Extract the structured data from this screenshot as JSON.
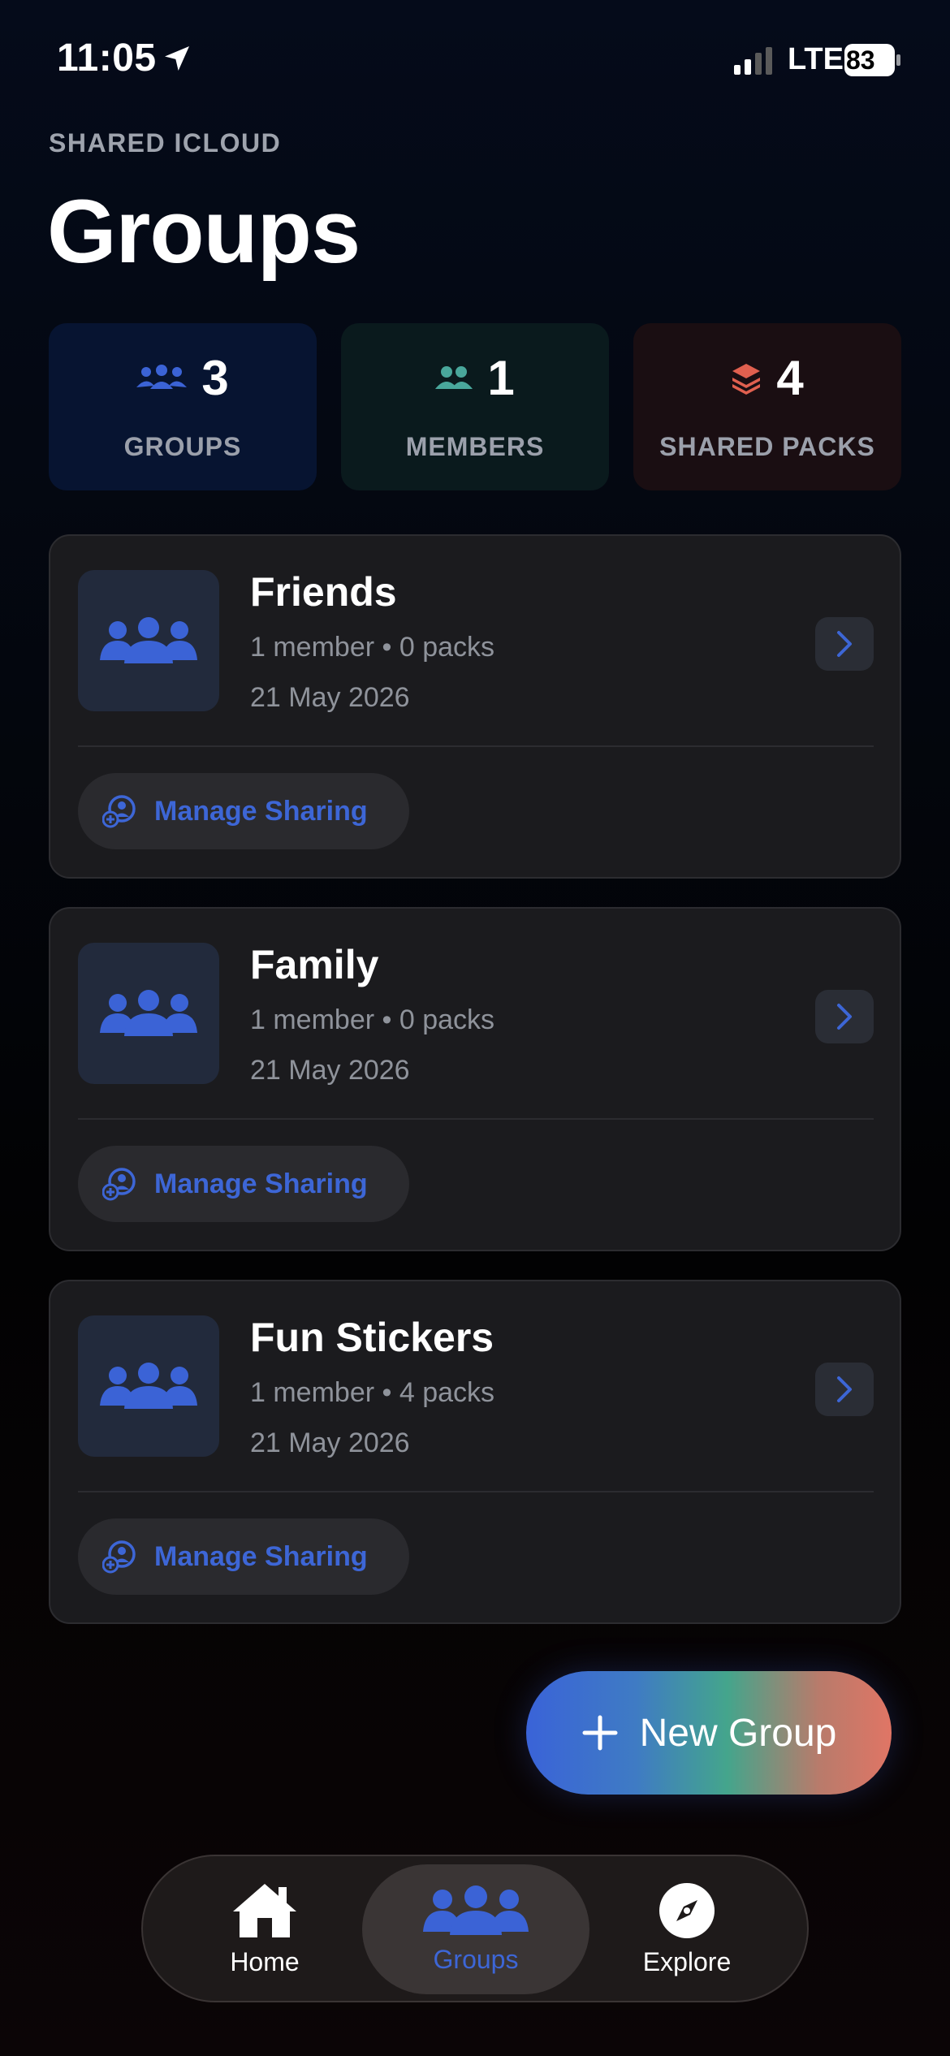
{
  "status_bar": {
    "time": "11:05",
    "network": "LTE",
    "battery": "83"
  },
  "header": {
    "eyebrow": "SHARED ICLOUD",
    "title": "Groups"
  },
  "stats": [
    {
      "value": "3",
      "label": "GROUPS",
      "icon": "people-icon",
      "color": "#3b63d6"
    },
    {
      "value": "1",
      "label": "MEMBERS",
      "icon": "two-people-icon",
      "color": "#49a79b"
    },
    {
      "value": "4",
      "label": "SHARED PACKS",
      "icon": "layers-icon",
      "color": "#e0604f"
    }
  ],
  "groups": [
    {
      "name": "Friends",
      "members": "1 member",
      "packs": "0 packs",
      "date": "21 May 2026",
      "action": "Manage Sharing"
    },
    {
      "name": "Family",
      "members": "1 member",
      "packs": "0 packs",
      "date": "21 May 2026",
      "action": "Manage Sharing"
    },
    {
      "name": "Fun Stickers",
      "members": "1 member",
      "packs": "4 packs",
      "date": "21 May 2026",
      "action": "Manage Sharing"
    }
  ],
  "fab": {
    "label": "New Group"
  },
  "tabs": [
    {
      "label": "Home",
      "icon": "house-icon",
      "active": false
    },
    {
      "label": "Groups",
      "icon": "people-icon",
      "active": true
    },
    {
      "label": "Explore",
      "icon": "compass-icon",
      "active": false
    }
  ],
  "colors": {
    "accent": "#3d66d6",
    "meta_text": "#8f939b"
  }
}
